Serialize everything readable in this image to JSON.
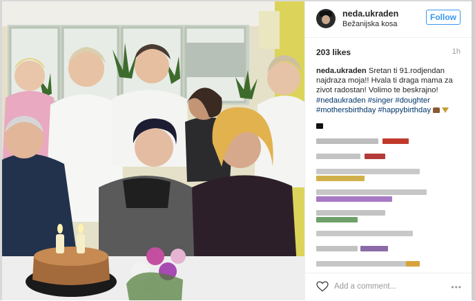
{
  "post": {
    "username": "neda.ukraden",
    "location": "Bežanijska kosa",
    "follow_label": "Follow",
    "likes": "203 likes",
    "time": "1h",
    "caption_user": "neda.ukraden",
    "caption_text": "Sretan ti 91.rodjendan najdraza moja!! Hvala ti draga mama za zivot radostan! Volimo te beskrajno!",
    "hashtags": [
      "#nedaukraden",
      "#singer",
      "#doughter",
      "#mothersbirthday",
      "#happybirthday"
    ],
    "comment_placeholder": "Add a comment...",
    "more_label": "•••"
  },
  "icons": {
    "heart": "heart-icon",
    "more": "more-icon",
    "avatar": "avatar",
    "cake_emoji": "cake-emoji-icon",
    "glass_emoji": "cocktail-emoji-icon"
  },
  "colors": {
    "accent": "#3897f0",
    "hashtag": "#003569",
    "muted": "#999999"
  }
}
